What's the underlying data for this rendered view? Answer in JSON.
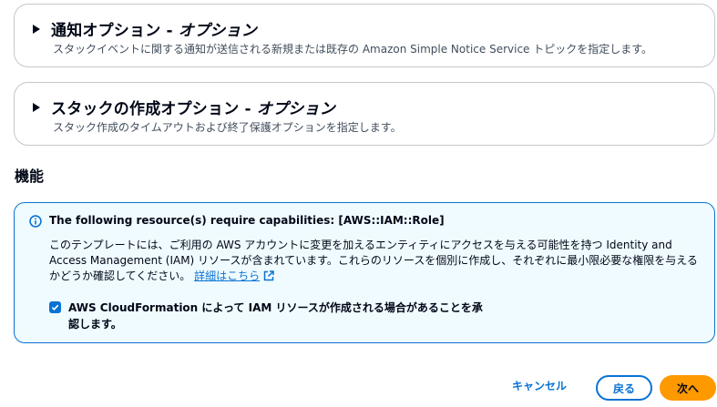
{
  "notification_panel": {
    "title_a": "通知オプション - ",
    "title_b": "オプション",
    "description": "スタックイベントに関する通知が送信される新規または既存の Amazon Simple Notice Service トピックを指定します。"
  },
  "stack_options_panel": {
    "title_a": "スタックの作成オプション - ",
    "title_b": "オプション",
    "description": "スタック作成のタイムアウトおよび終了保護オプションを指定します。"
  },
  "capabilities": {
    "section_title": "機能",
    "alert_title": "The following resource(s) require capabilities: [AWS::IAM::Role]",
    "alert_body": "このテンプレートには、ご利用の AWS アカウントに変更を加えるエンティティにアクセスを与える可能性を持つ Identity and Access Management (IAM) リソースが含まれています。これらのリソースを個別に作成し、それぞれに最小限必要な権限を与えるかどうか確認してください。",
    "learn_more_link": "詳細はこちら",
    "acknowledge_label": "AWS CloudFormation によって IAM リソースが作成される場合があることを承認します。",
    "acknowledge_checked": true
  },
  "footer": {
    "cancel_label": "キャンセル",
    "back_label": "戻る",
    "next_label": "次へ"
  },
  "colors": {
    "link": "#0972d3",
    "primary_button": "#ff9900",
    "alert_background": "#f0fbff"
  }
}
